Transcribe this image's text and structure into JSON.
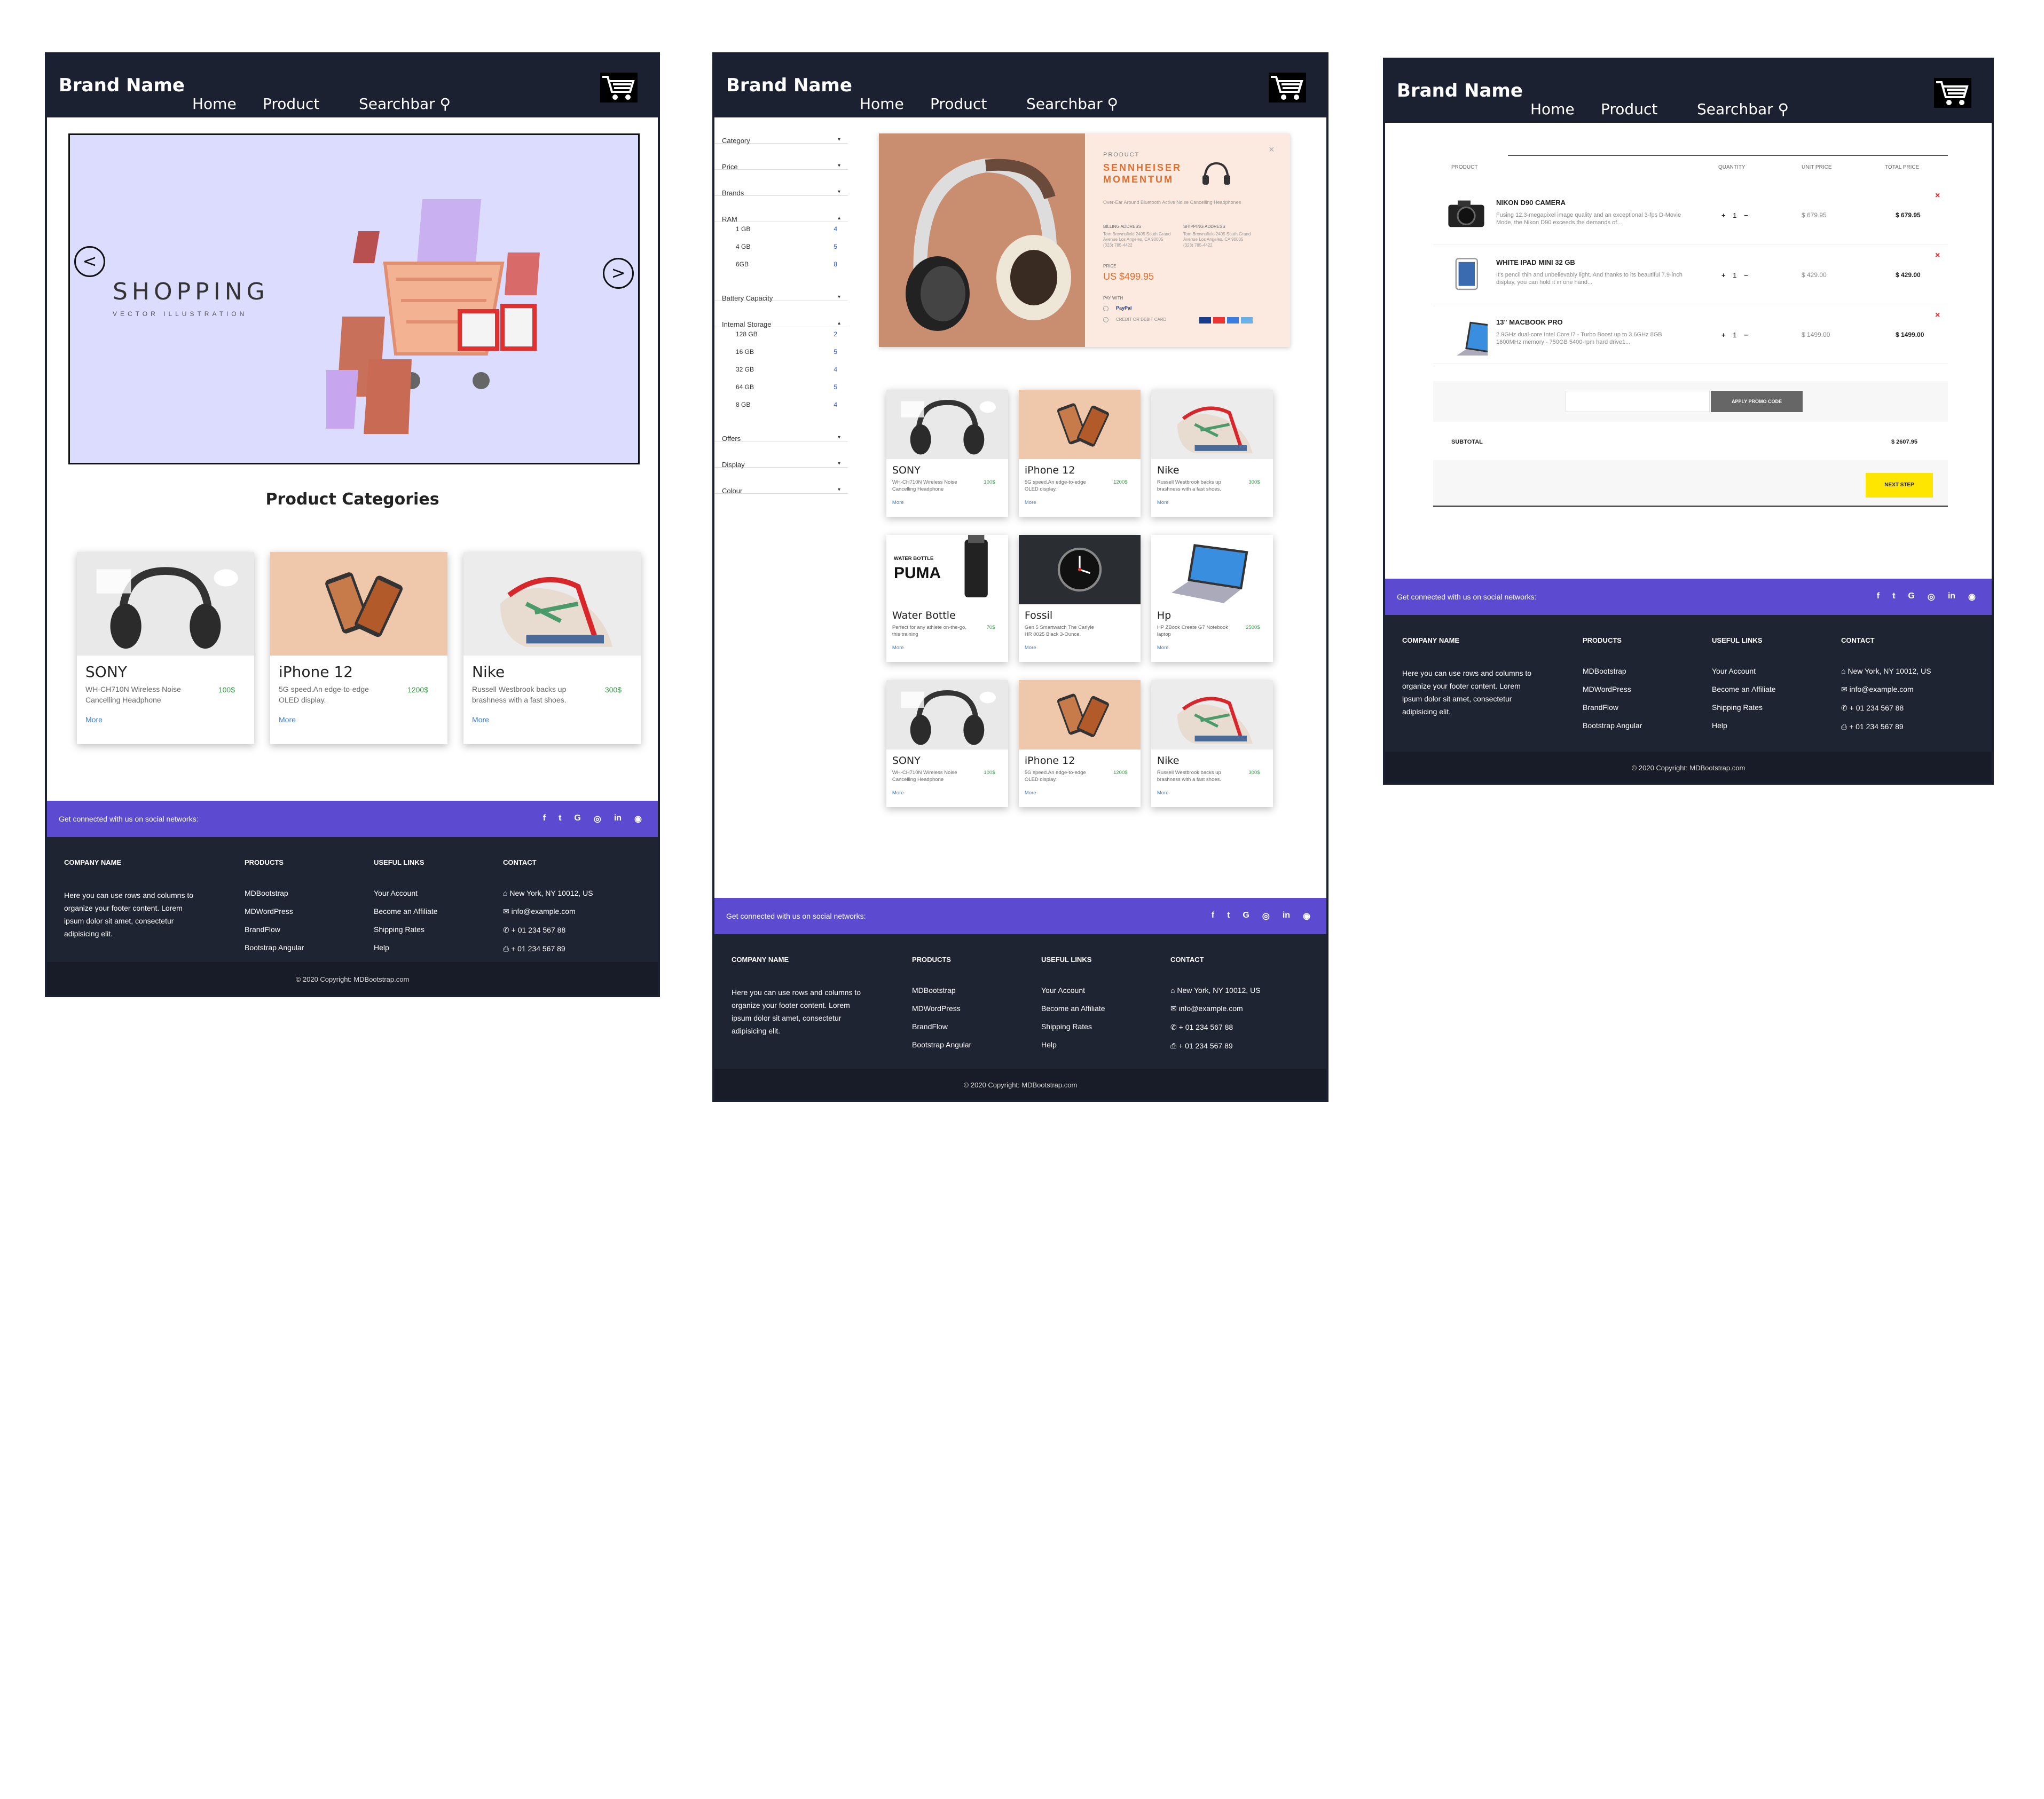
{
  "header": {
    "brand": "Brand Name",
    "nav_home": "Home",
    "nav_product": "Product",
    "nav_search": "Searchbar"
  },
  "colors": {
    "header_bg": "#1b2130",
    "social_bar": "#5c4ad0",
    "footer_bg": "#1f2433",
    "price": "#3a9a4a",
    "link": "#3b7fd6",
    "next_step": "#ffe600"
  },
  "home": {
    "hero_title": "SHOPPING",
    "hero_subtitle": "VECTOR ILLUSTRATION",
    "prev": "<",
    "next": ">",
    "section_title": "Product Categories",
    "cards": [
      {
        "name": "SONY",
        "desc": "WH-CH710N Wireless Noise Cancelling Headphone",
        "price": "100$",
        "more": "More",
        "icon": "headphones"
      },
      {
        "name": "iPhone 12",
        "desc": "5G speed.An edge-to-edge OLED display.",
        "price": "1200$",
        "more": "More",
        "icon": "phone"
      },
      {
        "name": "Nike",
        "desc": "Russell Westbrook backs up brashness with a fast shoes.",
        "price": "300$",
        "more": "More",
        "icon": "shoe"
      }
    ]
  },
  "products_page": {
    "filters": [
      {
        "label": "Category",
        "caret": "▾"
      },
      {
        "label": "Price",
        "caret": "▾"
      },
      {
        "label": "Brands",
        "caret": "▾"
      },
      {
        "label": "RAM",
        "caret": "▴",
        "options": [
          {
            "label": "1 GB",
            "count": "4"
          },
          {
            "label": "4 GB",
            "count": "5"
          },
          {
            "label": "6GB",
            "count": "8"
          }
        ]
      },
      {
        "label": "Battery Capacity",
        "caret": "▾"
      },
      {
        "label": "Internal Storage",
        "caret": "▴",
        "options": [
          {
            "label": "128 GB",
            "count": "2"
          },
          {
            "label": "16 GB",
            "count": "5"
          },
          {
            "label": "32 GB",
            "count": "4"
          },
          {
            "label": "64 GB",
            "count": "5"
          },
          {
            "label": "8 GB",
            "count": "4"
          }
        ]
      },
      {
        "label": "Offers",
        "caret": "▾"
      },
      {
        "label": "Display",
        "caret": "▾"
      },
      {
        "label": "Colour",
        "caret": "▾"
      }
    ],
    "modal": {
      "kicker": "PRODUCT",
      "title_line1": "SENNHEISER",
      "title_line2": "MOMENTUM",
      "tagline": "Over-Ear Around Bluetooth Active Noise Cancelling Headphones",
      "billing_label": "BILLING ADDRESS",
      "billing_value": "Tom Brownsfield 2405 South Grand Avenue Los Angeles, CA 90005 (323) 785-4422",
      "shipping_label": "SHIPPING ADDRESS",
      "shipping_value": "Tom Brownsfield 2405 South Grand Avenue Los Angeles, CA 90005 (323) 785-4422",
      "price_label": "PRICE",
      "price": "US $499.95",
      "pay_with": "PAY WITH",
      "opt_paypal": "PayPal",
      "opt_card": "CREDIT OR DEBIT CARD",
      "close": "×"
    },
    "grid": [
      {
        "name": "SONY",
        "desc": "WH-CH710N Wireless Noise Cancelling Headphone",
        "price": "100$",
        "more": "More",
        "icon": "headphones"
      },
      {
        "name": "iPhone 12",
        "desc": "5G speed.An edge-to-edge OLED display.",
        "price": "1200$",
        "more": "More",
        "icon": "phone"
      },
      {
        "name": "Nike",
        "desc": "Russell Westbrook backs up brashness with a fast shoes.",
        "price": "300$",
        "more": "More",
        "icon": "shoe"
      },
      {
        "name": "Water Bottle",
        "desc": "Perfect for any athlete on-the-go, this training",
        "price": "70$",
        "more": "More",
        "icon": "bottle",
        "brand_text_1": "WATER BOTTLE",
        "brand_text_2": "PUMA"
      },
      {
        "name": "Fossil",
        "desc": "Gen 5 Smartwatch The Carlyle HR 0025 Black 3-Ounce.",
        "price": "",
        "more": "More",
        "icon": "watch"
      },
      {
        "name": "Hp",
        "desc": "HP ZBook Create G7 Notebook laptop",
        "price": "2500$",
        "more": "More",
        "icon": "laptop"
      },
      {
        "name": "SONY",
        "desc": "WH-CH710N Wireless Noise Cancelling Headphone",
        "price": "100$",
        "more": "More",
        "icon": "headphones"
      },
      {
        "name": "iPhone 12",
        "desc": "5G speed.An edge-to-edge OLED display.",
        "price": "1200$",
        "more": "More",
        "icon": "phone"
      },
      {
        "name": "Nike",
        "desc": "Russell Westbrook backs up brashness with a fast shoes.",
        "price": "300$",
        "more": "More",
        "icon": "shoe"
      }
    ]
  },
  "cart_page": {
    "col_product": "PRODUCT",
    "col_quantity": "QUANTITY",
    "col_unit": "UNIT PRICE",
    "col_total": "TOTAL PRICE",
    "items": [
      {
        "name": "NIKON D90 CAMERA",
        "desc": "Fusing 12.3-megapixel image quality and an exceptional 3-fps D-Movie Mode, the Nikon D90 exceeds the demands of...",
        "qty": "1",
        "unit": "$ 679.95",
        "total": "$ 679.95",
        "icon": "camera"
      },
      {
        "name": "WHITE IPAD MINI 32 GB",
        "desc": "It's pencil thin and unbelievably light. And thanks to its beautiful 7.9-inch display, you can hold it in one hand...",
        "qty": "1",
        "unit": "$ 429.00",
        "total": "$ 429.00",
        "icon": "tablet"
      },
      {
        "name": "13\" MACBOOK PRO",
        "desc": "2.9GHz dual-core Intel Core i7 - Turbo Boost up to 3.6GHz 8GB 1600MHz memory - 750GB 5400-rpm hard drive1...",
        "qty": "1",
        "unit": "$ 1499.00",
        "total": "$ 1499.00",
        "icon": "laptop"
      }
    ],
    "promo_placeholder": "",
    "promo_button": "APPLY PROMO CODE",
    "subtotal_label": "SUBTOTAL",
    "subtotal": "$ 2607.95",
    "next_button": "NEXT STEP",
    "remove": "×",
    "plus": "+",
    "minus": "−"
  },
  "footer": {
    "social_text": "Get connected with us on social networks:",
    "social_icons": [
      "f",
      "t",
      "G",
      "◎",
      "in",
      "◉"
    ],
    "company_title": "COMPANY NAME",
    "company_text": "Here you can use rows and columns to organize your footer content. Lorem ipsum dolor sit amet, consectetur adipisicing elit.",
    "products_title": "PRODUCTS",
    "products": [
      "MDBootstrap",
      "MDWordPress",
      "BrandFlow",
      "Bootstrap Angular"
    ],
    "links_title": "USEFUL LINKS",
    "links": [
      "Your Account",
      "Become an Affiliate",
      "Shipping Rates",
      "Help"
    ],
    "contact_title": "CONTACT",
    "contact": [
      "New York, NY 10012, US",
      "info@example.com",
      "+ 01 234 567 88",
      "+ 01 234 567 89"
    ],
    "contact_icons": [
      "home-icon",
      "envelope-icon",
      "phone-icon",
      "print-icon"
    ],
    "copyright": "© 2020 Copyright: MDBootstrap.com"
  }
}
